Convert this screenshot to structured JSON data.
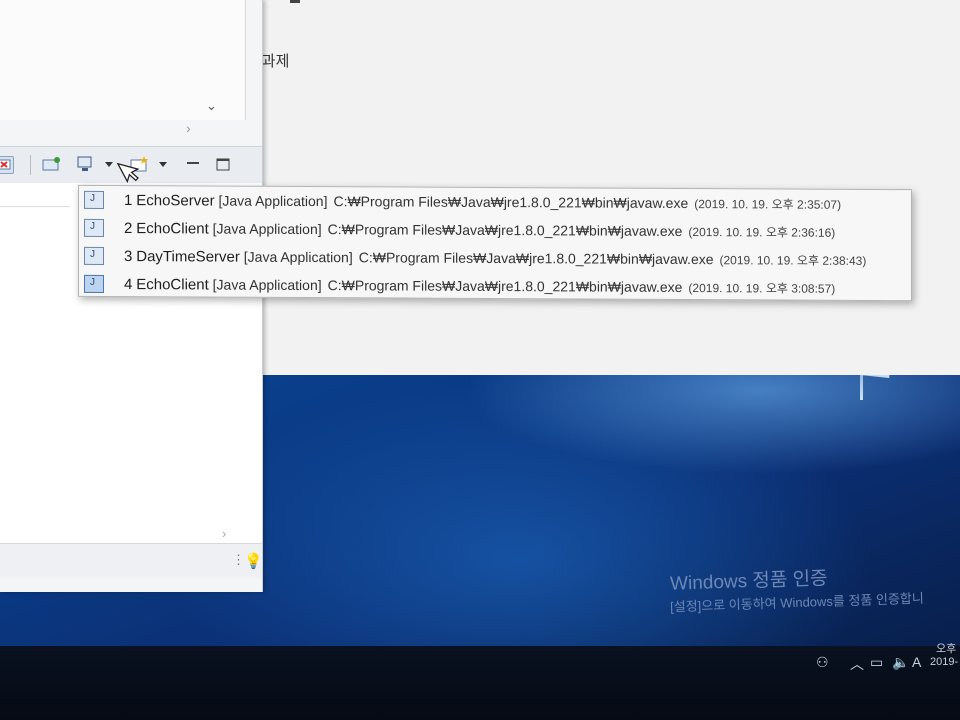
{
  "document": {
    "text": "습과제"
  },
  "toolbar": {
    "icons": [
      "display-selected-console-icon",
      "pin-console-icon",
      "display-console-icon",
      "dropdown-arrow-icon",
      "open-console-icon",
      "minimize-icon",
      "maximize-icon"
    ]
  },
  "dropdown": {
    "items": [
      {
        "index": "1",
        "name": "EchoServer",
        "type": "[Java Application]",
        "path": "C:₩Program Files₩Java₩jre1.8.0_221₩bin₩javaw.exe",
        "time": "(2019. 10. 19. 오후 2:35:07)",
        "selected": false
      },
      {
        "index": "2",
        "name": "EchoClient",
        "type": "[Java Application]",
        "path": "C:₩Program Files₩Java₩jre1.8.0_221₩bin₩javaw.exe",
        "time": "(2019. 10. 19. 오후 2:36:16)",
        "selected": false
      },
      {
        "index": "3",
        "name": "DayTimeServer",
        "type": "[Java Application]",
        "path": "C:₩Program Files₩Java₩jre1.8.0_221₩bin₩javaw.exe",
        "time": "(2019. 10. 19. 오후 2:38:43)",
        "selected": false
      },
      {
        "index": "4",
        "name": "EchoClient",
        "type": "[Java Application]",
        "path": "C:₩Program Files₩Java₩jre1.8.0_221₩bin₩javaw.exe",
        "time": "(2019. 10. 19. 오후 3:08:57)",
        "selected": true
      }
    ]
  },
  "watermark": {
    "title": "Windows 정품 인증",
    "subtitle": "[설정]으로 이동하여 Windows를 정품 인증합니"
  },
  "taskbar": {
    "ime": "A",
    "clock_time": "오후",
    "clock_date": "2019-"
  },
  "colors": {
    "accent": "#4a78b0",
    "wallpaper": "#0a3f8c"
  }
}
